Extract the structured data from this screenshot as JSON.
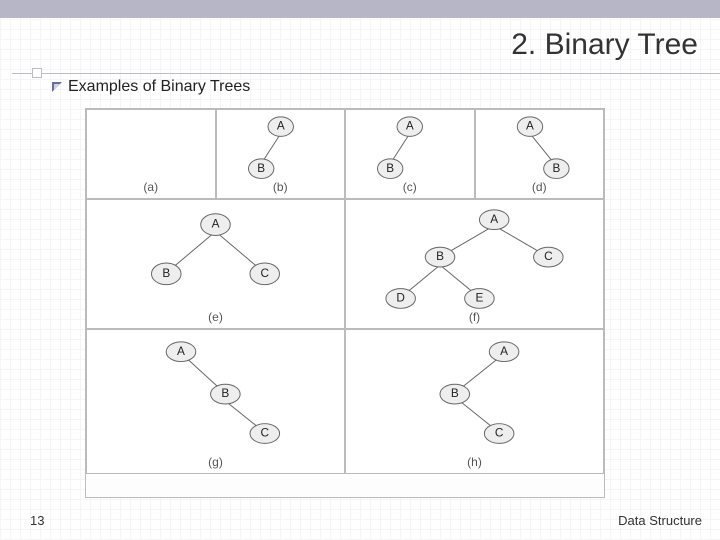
{
  "header": {
    "title": "2. Binary Tree",
    "subtitle": "Examples of Binary Trees"
  },
  "captions": {
    "a": "(a)",
    "b": "(b)",
    "c": "(c)",
    "d": "(d)",
    "e": "(e)",
    "f": "(f)",
    "g": "(g)",
    "h": "(h)"
  },
  "trees": {
    "b": {
      "root": "A",
      "child": "B",
      "side": "left"
    },
    "c": {
      "root": "A",
      "child": "B",
      "side": "left"
    },
    "d": {
      "root": "A",
      "child": "B",
      "side": "right"
    },
    "e": {
      "root": "A",
      "left": "B",
      "right": "C"
    },
    "f": {
      "root": "A",
      "left": "B",
      "right": "C",
      "leftleft": "D",
      "leftright": "E"
    },
    "g": {
      "n1": "A",
      "n2": "B",
      "n3": "C"
    },
    "h": {
      "n1": "A",
      "n2": "B",
      "n3": "C"
    }
  },
  "footer": {
    "page": "13",
    "label": "Data Structure"
  }
}
